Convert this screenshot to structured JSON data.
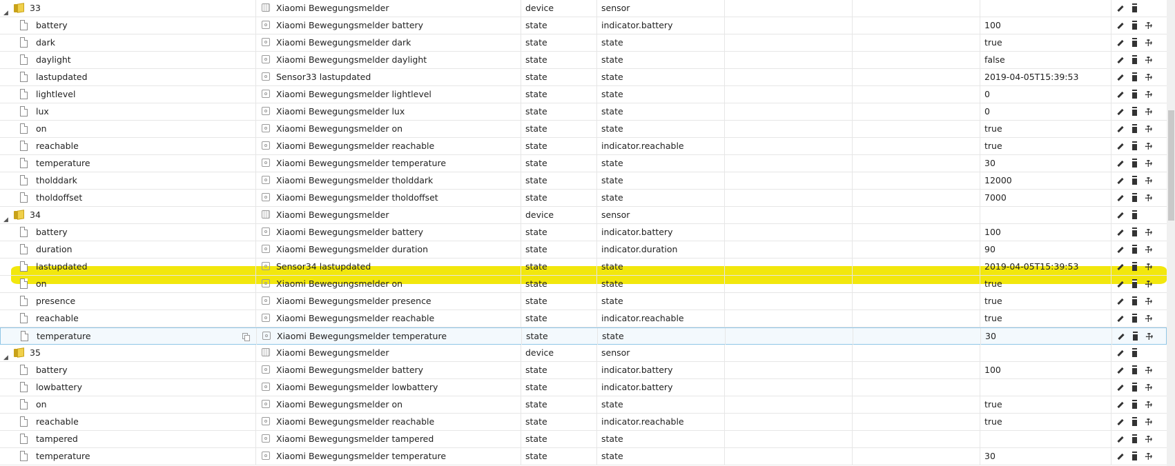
{
  "rows": [
    {
      "kind": "folder",
      "name": "33",
      "label": "Xiaomi Bewegungsmelder",
      "type": "device",
      "role": "sensor",
      "value": "",
      "wrench": false
    },
    {
      "kind": "state",
      "name": "battery",
      "label": "Xiaomi Bewegungsmelder battery",
      "type": "state",
      "role": "indicator.battery",
      "value": "100",
      "wrench": true
    },
    {
      "kind": "state",
      "name": "dark",
      "label": "Xiaomi Bewegungsmelder dark",
      "type": "state",
      "role": "state",
      "value": "true",
      "wrench": true
    },
    {
      "kind": "state",
      "name": "daylight",
      "label": "Xiaomi Bewegungsmelder daylight",
      "type": "state",
      "role": "state",
      "value": "false",
      "wrench": true
    },
    {
      "kind": "state",
      "name": "lastupdated",
      "label": "Sensor33 lastupdated",
      "type": "state",
      "role": "state",
      "value": "2019-04-05T15:39:53",
      "wrench": true
    },
    {
      "kind": "state",
      "name": "lightlevel",
      "label": "Xiaomi Bewegungsmelder lightlevel",
      "type": "state",
      "role": "state",
      "value": "0",
      "wrench": true
    },
    {
      "kind": "state",
      "name": "lux",
      "label": "Xiaomi Bewegungsmelder lux",
      "type": "state",
      "role": "state",
      "value": "0",
      "wrench": true
    },
    {
      "kind": "state",
      "name": "on",
      "label": "Xiaomi Bewegungsmelder on",
      "type": "state",
      "role": "state",
      "value": "true",
      "wrench": true
    },
    {
      "kind": "state",
      "name": "reachable",
      "label": "Xiaomi Bewegungsmelder reachable",
      "type": "state",
      "role": "indicator.reachable",
      "value": "true",
      "wrench": true
    },
    {
      "kind": "state",
      "name": "temperature",
      "label": "Xiaomi Bewegungsmelder temperature",
      "type": "state",
      "role": "state",
      "value": "30",
      "wrench": true
    },
    {
      "kind": "state",
      "name": "tholddark",
      "label": "Xiaomi Bewegungsmelder tholddark",
      "type": "state",
      "role": "state",
      "value": "12000",
      "wrench": true
    },
    {
      "kind": "state",
      "name": "tholdoffset",
      "label": "Xiaomi Bewegungsmelder tholdoffset",
      "type": "state",
      "role": "state",
      "value": "7000",
      "wrench": true
    },
    {
      "kind": "folder",
      "name": "34",
      "label": "Xiaomi Bewegungsmelder",
      "type": "device",
      "role": "sensor",
      "value": "",
      "wrench": false
    },
    {
      "kind": "state",
      "name": "battery",
      "label": "Xiaomi Bewegungsmelder battery",
      "type": "state",
      "role": "indicator.battery",
      "value": "100",
      "wrench": true
    },
    {
      "kind": "state",
      "name": "duration",
      "label": "Xiaomi Bewegungsmelder duration",
      "type": "state",
      "role": "indicator.duration",
      "value": "90",
      "wrench": true
    },
    {
      "kind": "state",
      "name": "lastupdated",
      "label": "Sensor34 lastupdated",
      "type": "state",
      "role": "state",
      "value": "2019-04-05T15:39:53",
      "wrench": true
    },
    {
      "kind": "state",
      "name": "on",
      "label": "Xiaomi Bewegungsmelder on",
      "type": "state",
      "role": "state",
      "value": "true",
      "wrench": true
    },
    {
      "kind": "state",
      "name": "presence",
      "label": "Xiaomi Bewegungsmelder presence",
      "type": "state",
      "role": "state",
      "value": "true",
      "wrench": true,
      "highlighted": true
    },
    {
      "kind": "state",
      "name": "reachable",
      "label": "Xiaomi Bewegungsmelder reachable",
      "type": "state",
      "role": "indicator.reachable",
      "value": "true",
      "wrench": true
    },
    {
      "kind": "state",
      "name": "temperature",
      "label": "Xiaomi Bewegungsmelder temperature",
      "type": "state",
      "role": "state",
      "value": "30",
      "wrench": true,
      "selected": true
    },
    {
      "kind": "folder",
      "name": "35",
      "label": "Xiaomi Bewegungsmelder",
      "type": "device",
      "role": "sensor",
      "value": "",
      "wrench": false
    },
    {
      "kind": "state",
      "name": "battery",
      "label": "Xiaomi Bewegungsmelder battery",
      "type": "state",
      "role": "indicator.battery",
      "value": "100",
      "wrench": true
    },
    {
      "kind": "state",
      "name": "lowbattery",
      "label": "Xiaomi Bewegungsmelder lowbattery",
      "type": "state",
      "role": "indicator.battery",
      "value": "",
      "wrench": true
    },
    {
      "kind": "state",
      "name": "on",
      "label": "Xiaomi Bewegungsmelder on",
      "type": "state",
      "role": "state",
      "value": "true",
      "wrench": true
    },
    {
      "kind": "state",
      "name": "reachable",
      "label": "Xiaomi Bewegungsmelder reachable",
      "type": "state",
      "role": "indicator.reachable",
      "value": "true",
      "wrench": true
    },
    {
      "kind": "state",
      "name": "tampered",
      "label": "Xiaomi Bewegungsmelder tampered",
      "type": "state",
      "role": "state",
      "value": "",
      "wrench": true
    },
    {
      "kind": "state",
      "name": "temperature",
      "label": "Xiaomi Bewegungsmelder temperature",
      "type": "state",
      "role": "state",
      "value": "30",
      "wrench": true
    }
  ],
  "colors": {
    "highlight": "#f1e600",
    "selected_border": "#8fc6e6",
    "folder": "#f0d04b"
  },
  "icons": {
    "folder": "folder-icon",
    "file": "file-icon",
    "edit": "pencil-icon",
    "delete": "trash-icon",
    "custom": "wrench-icon",
    "copy": "copy-icon",
    "expand": "collapse-triangle-icon"
  }
}
